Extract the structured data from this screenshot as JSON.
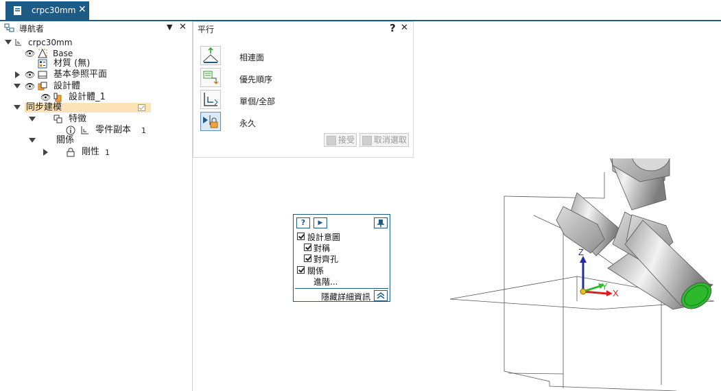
{
  "tab": {
    "title": "crpc30mm",
    "close": "✕"
  },
  "navigator": {
    "title": "導航者",
    "pin": "▼",
    "close": "✕",
    "tree": {
      "root": "crpc30mm",
      "base": "Base",
      "material": "材質 (無)",
      "ref_planes": "基本參照平面",
      "design_bodies": "設計體",
      "design_body_1": "設計體_1",
      "sync_modeling": "同步建模",
      "features": "特徵",
      "part_copy": "零件副本",
      "part_copy_count": "1",
      "relations": "關係",
      "rigid": "剛性",
      "rigid_count": "1"
    }
  },
  "parallel_panel": {
    "title": "平行",
    "help": "?",
    "close": "✕",
    "options": [
      "相連面",
      "優先順序",
      "單個/全部",
      "永久"
    ],
    "accept": "接受",
    "deselect": "取消選取"
  },
  "design_intent": {
    "help": "?",
    "play": "▶",
    "items": {
      "design_intent": "設計意圖",
      "symmetric": "對稱",
      "align_holes": "對齊孔",
      "relations": "關係",
      "advanced": "進階..."
    },
    "hide_details": "隱藏詳細資訊"
  },
  "triad": {
    "z": "Z",
    "y": "Y",
    "x": "X"
  },
  "colors": {
    "accent": "#1d5b87",
    "sync_highlight": "#fde3b5",
    "face_green": "#2db82d"
  }
}
